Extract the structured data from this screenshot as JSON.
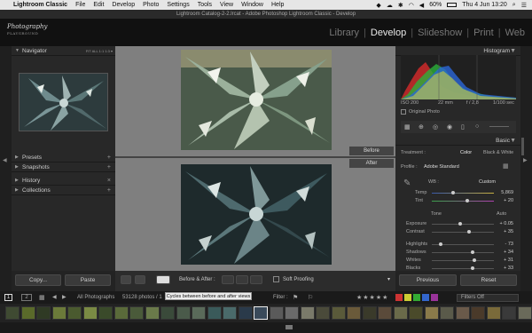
{
  "menubar": {
    "apple": "",
    "items": [
      "Lightroom Classic",
      "File",
      "Edit",
      "Develop",
      "Photo",
      "Settings",
      "Tools",
      "View",
      "Window",
      "Help"
    ],
    "battery": "60%",
    "datetime": "Thu 4 Jun  13:20"
  },
  "window": {
    "title": "Lightroom Catalog-2-2.lrcat - Adobe Photoshop Lightroom Classic - Develop"
  },
  "logo": {
    "line1": "Photography",
    "line2": "PLAYGROUND"
  },
  "modules": {
    "items": [
      "Library",
      "Develop",
      "Slideshow",
      "Print",
      "Web"
    ],
    "active": "Develop"
  },
  "left": {
    "navigator": "Navigator",
    "nav_opts": "FIT   ALL   1:1   1:3 ▾",
    "panels": [
      "Presets",
      "Snapshots",
      "History",
      "Collections"
    ],
    "copy": "Copy...",
    "paste": "Paste"
  },
  "center": {
    "before": "Before",
    "after": "After",
    "toolbar_label": "Before & After :",
    "soft_proofing": "Soft Proofing"
  },
  "right": {
    "histogram": "Histogram",
    "iso": "ISO 200",
    "focal": "22 mm",
    "aperture": "f / 2,8",
    "shutter": "1/100 sec",
    "original_photo": "Original Photo",
    "basic": "Basic",
    "treatment_label": "Treatment :",
    "treatment_color": "Color",
    "treatment_bw": "Black & White",
    "profile_label": "Profile :",
    "profile_value": "Adobe Standard",
    "wb_label": "WB :",
    "wb_value": "Custom",
    "temp_label": "Temp",
    "temp_value": "5,869",
    "tint_label": "Tint",
    "tint_value": "+ 20",
    "tone_label": "Tone",
    "auto_label": "Auto",
    "exposure_label": "Exposure",
    "exposure_value": "+ 0.05",
    "contrast_label": "Contrast",
    "contrast_value": "+ 35",
    "highlights_label": "Highlights",
    "highlights_value": "- 73",
    "shadows_label": "Shadows",
    "shadows_value": "+ 34",
    "whites_label": "Whites",
    "whites_value": "+ 31",
    "blacks_label": "Blacks",
    "blacks_value": "+ 33",
    "previous": "Previous",
    "reset": "Reset"
  },
  "filmstrip": {
    "page1": "1",
    "page2": "2",
    "source": "All Photographs",
    "count": "53128 photos / 1",
    "tooltip": "Cycles between before and after views",
    "filter_label": "Filter :",
    "filters_off": "Filters Off"
  },
  "colors": {
    "accent": "#e8e8e8",
    "panel": "#282828",
    "center": "#7f7f7f"
  }
}
